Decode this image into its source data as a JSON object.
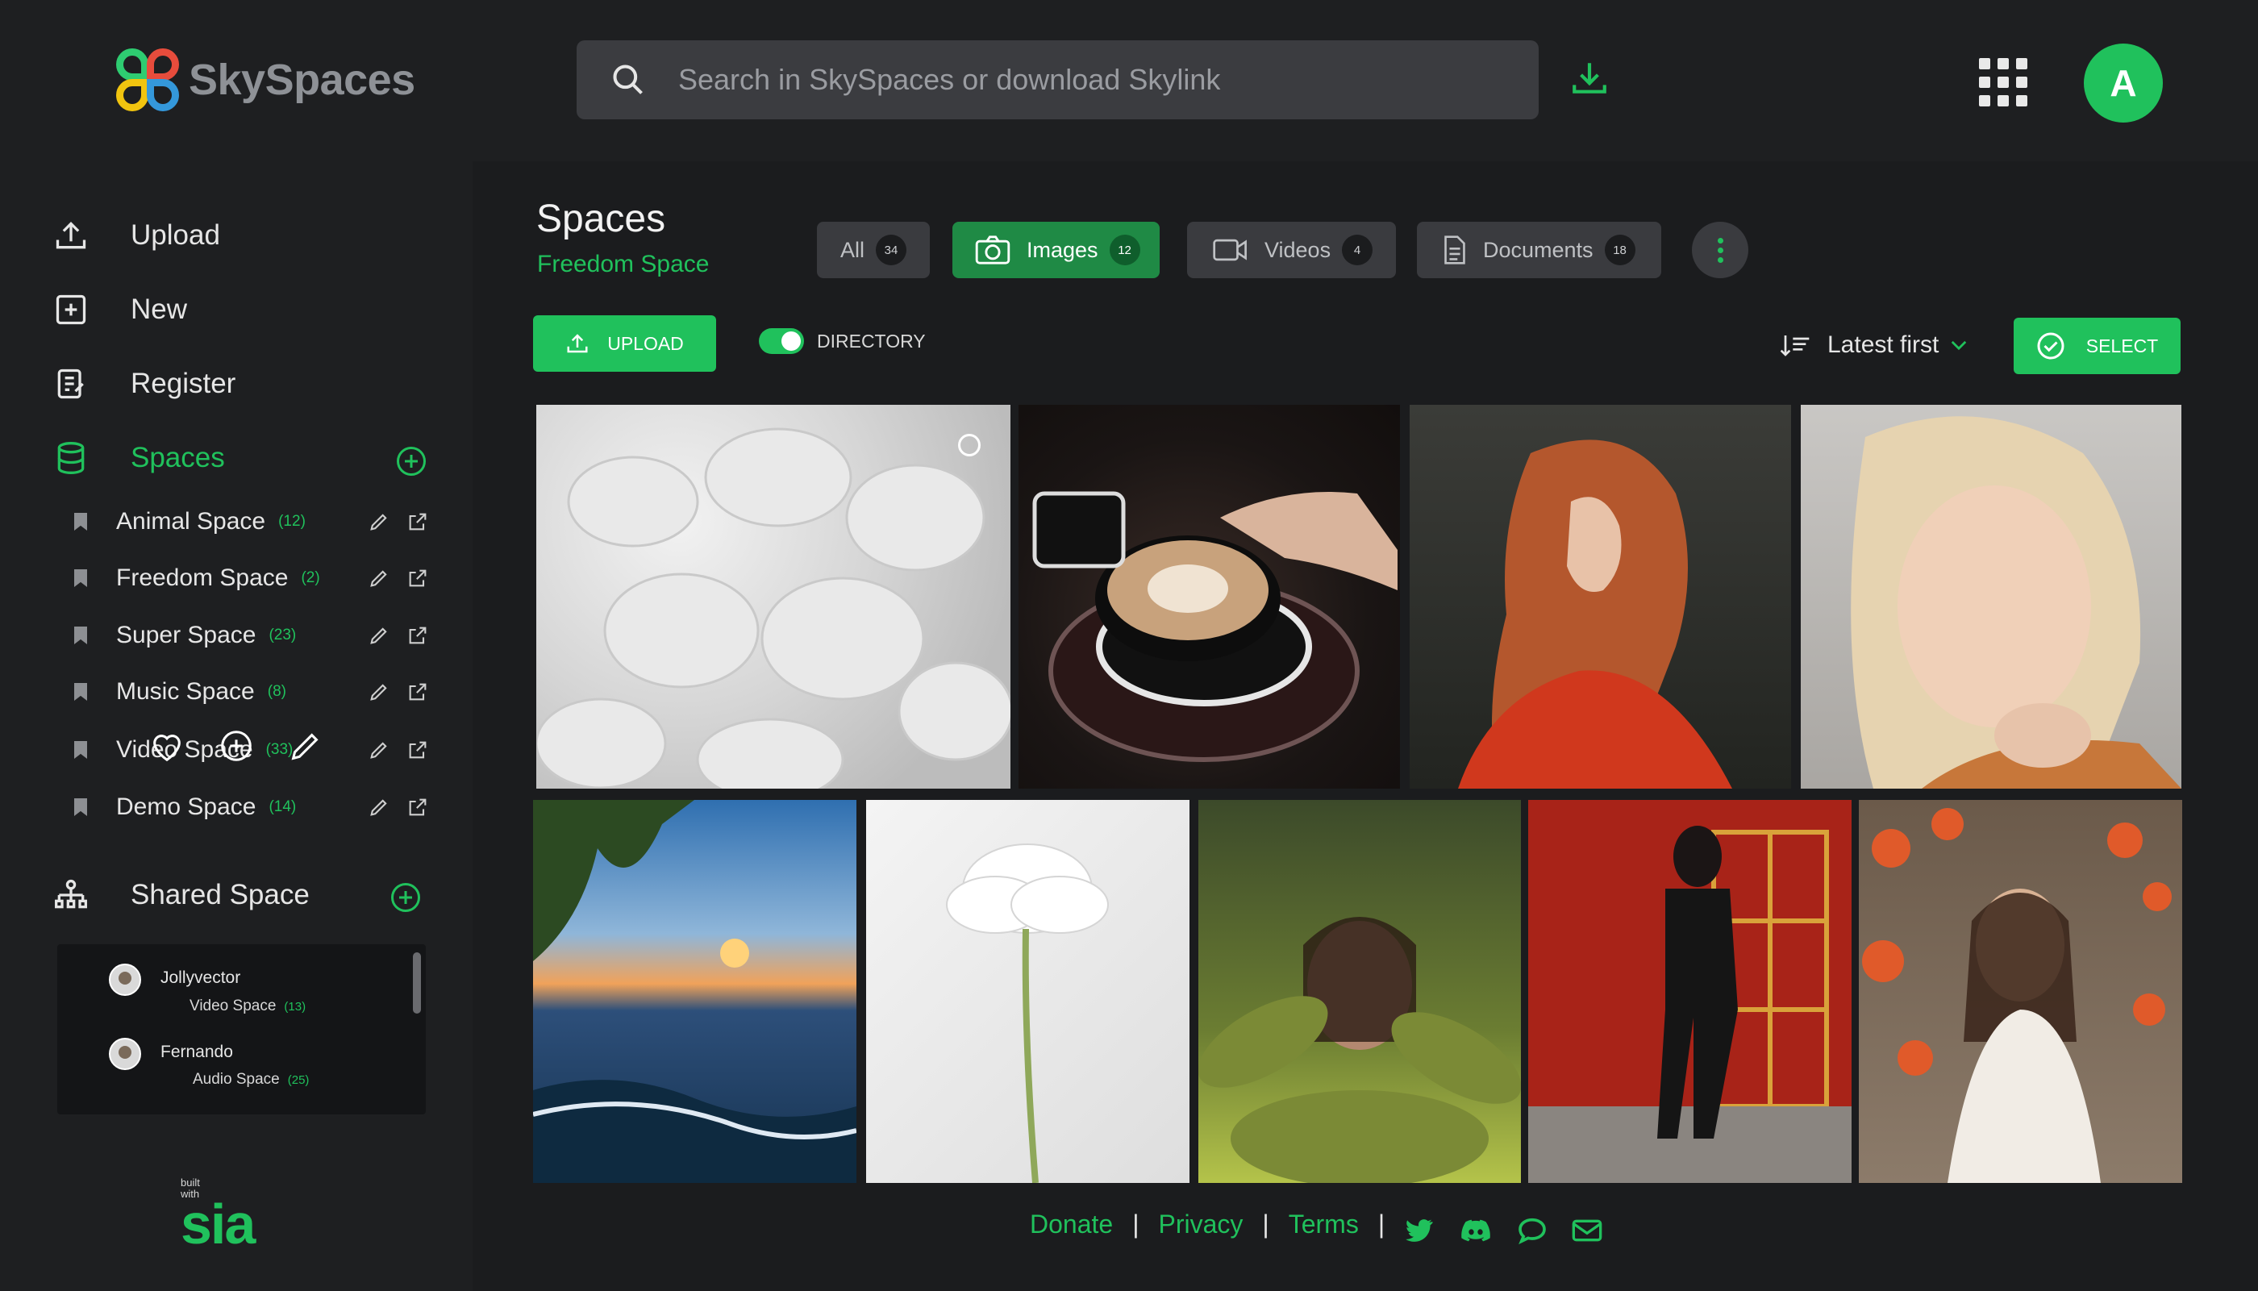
{
  "app": {
    "name": "SkySpaces",
    "avatar_initial": "A"
  },
  "search": {
    "placeholder": "Search in SkySpaces or download Skylink"
  },
  "nav": {
    "upload": "Upload",
    "new": "New",
    "register": "Register",
    "spaces": "Spaces",
    "shared": "Shared Space"
  },
  "spaces": [
    {
      "name": "Animal Space",
      "count": "(12)"
    },
    {
      "name": "Freedom Space",
      "count": "(2)"
    },
    {
      "name": "Super Space",
      "count": "(23)"
    },
    {
      "name": "Music Space",
      "count": "(8)"
    },
    {
      "name": "Video Space",
      "count": "(33)"
    },
    {
      "name": "Demo Space",
      "count": "(14)"
    }
  ],
  "shared": [
    {
      "user": "Jollyvector",
      "space": "Video Space",
      "count": "(13)"
    },
    {
      "user": "Fernando",
      "space": "Audio Space",
      "count": "(25)"
    }
  ],
  "branding": {
    "built": "built",
    "with": "with",
    "sia": "sia"
  },
  "main": {
    "title": "Spaces",
    "subtitle": "Freedom Space",
    "tabs": [
      {
        "label": "All",
        "count": "34",
        "active": false
      },
      {
        "label": "Images",
        "count": "12",
        "active": true
      },
      {
        "label": "Videos",
        "count": "4",
        "active": false
      },
      {
        "label": "Documents",
        "count": "18",
        "active": false
      }
    ],
    "upload_label": "UPLOAD",
    "directory_label": "DIRECTORY",
    "directory_on": true,
    "sort_label": "Latest first",
    "select_label": "SELECT"
  },
  "tiles": [
    {
      "subject": "seashells"
    },
    {
      "subject": "latte coffee cup"
    },
    {
      "subject": "red-haired woman"
    },
    {
      "subject": "blonde woman"
    },
    {
      "subject": "sunset over water"
    },
    {
      "subject": "white flower"
    },
    {
      "subject": "woman among plants"
    },
    {
      "subject": "woman walking by red doors"
    },
    {
      "subject": "woman with red flowers"
    }
  ],
  "footer": {
    "donate": "Donate",
    "privacy": "Privacy",
    "terms": "Terms"
  },
  "colors": {
    "accent": "#20c15c",
    "background": "#1b1c1e",
    "panel": "#1e1f21"
  }
}
